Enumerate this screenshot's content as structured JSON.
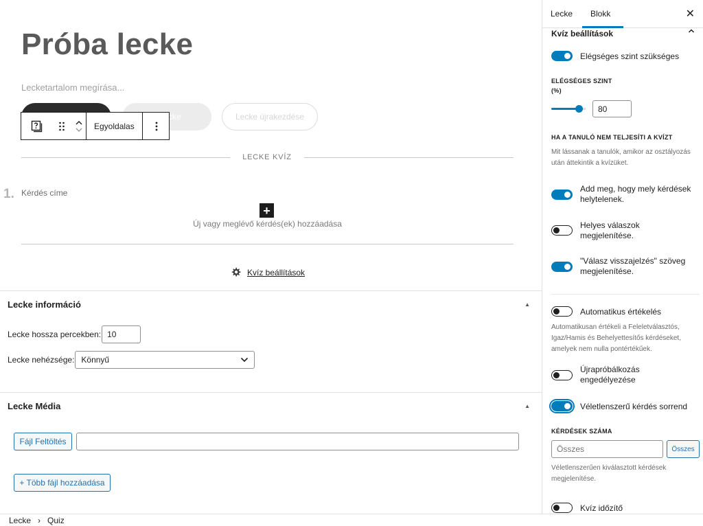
{
  "editor": {
    "title": "Próba lecke",
    "content_placeholder": "Lecketartalom megírása...",
    "buttons": {
      "pill_gray_label": "s Lecke",
      "pill_outline_label": "Lecke újrakezdése"
    },
    "block_toolbar": {
      "quiz_icon": "quiz-block-icon",
      "drag_icon": "drag-handle-icon",
      "move_up": "chevron-up-icon",
      "move_down": "chevron-down-icon",
      "style_label": "Egyoldalas",
      "more_icon": "more-vertical-icon"
    },
    "quiz": {
      "separator_label": "LECKE KVÍZ",
      "question_number": "1.",
      "question_title": "Kérdés címe",
      "add_icon": "plus-icon",
      "add_label": "Új vagy meglévő kérdés(ek) hozzáadása",
      "settings_icon": "gear-icon",
      "settings_link": "Kvíz beállítások"
    }
  },
  "meta_info": {
    "title": "Lecke információ",
    "length_label": "Lecke hossza percekben:",
    "length_value": "10",
    "difficulty_label": "Lecke nehézsége:",
    "difficulty_value": "Könnyű"
  },
  "meta_media": {
    "title": "Lecke Média",
    "upload_button": "Fájl Feltöltés",
    "upload_value": "",
    "add_more_button": "+ Több fájl hozzáadása"
  },
  "breadcrumb": {
    "items": [
      "Lecke",
      "Quiz"
    ],
    "separator": "›"
  },
  "sidebar": {
    "tabs": [
      "Lecke",
      "Blokk"
    ],
    "active_tab": "Blokk",
    "close_icon": "close-icon",
    "section_title": "Kvíz beállítások",
    "pass_required": {
      "label": "Elégséges szint szükséges",
      "on": true
    },
    "pass_level_caption": "ELÉGSÉGES SZINT",
    "pass_level_unit": "(%)",
    "pass_level_value": "80",
    "pass_level_fraction": 0.8,
    "fail_caption": "HA A TANULÓ NEM TELJESÍTI A KVÍZT",
    "fail_help": "Mit lássanak a tanulók, amikor az osztályozás után áttekintik a kvízüket.",
    "show_incorrect": {
      "label": "Add meg, hogy mely kérdések helytelenek.",
      "on": true
    },
    "show_correct": {
      "label": "Helyes válaszok megjelenítése.",
      "on": false
    },
    "show_feedback": {
      "label": "\"Válasz visszajelzés\" szöveg megjelenítése.",
      "on": true
    },
    "auto_grade": {
      "label": "Automatikus értékelés",
      "on": false
    },
    "auto_grade_help": "Automatikusan értékeli a Feleletválasztós, Igaz/Hamis és Behelyettesítős kérdéseket, amelyek nem nulla pontértékűek.",
    "allow_retry": {
      "label": "Újrapróbálkozás engedélyezése",
      "on": false
    },
    "random_order": {
      "label": "Véletlenszerű kérdés sorrend",
      "on": true
    },
    "count_caption": "KÉRDÉSEK SZÁMA",
    "count_placeholder": "Összes",
    "count_button": "Összes",
    "count_help": "Véletlenszerűen kiválasztott kérdések megjelenítése.",
    "timer": {
      "label": "Kvíz időzítő",
      "on": false
    }
  }
}
